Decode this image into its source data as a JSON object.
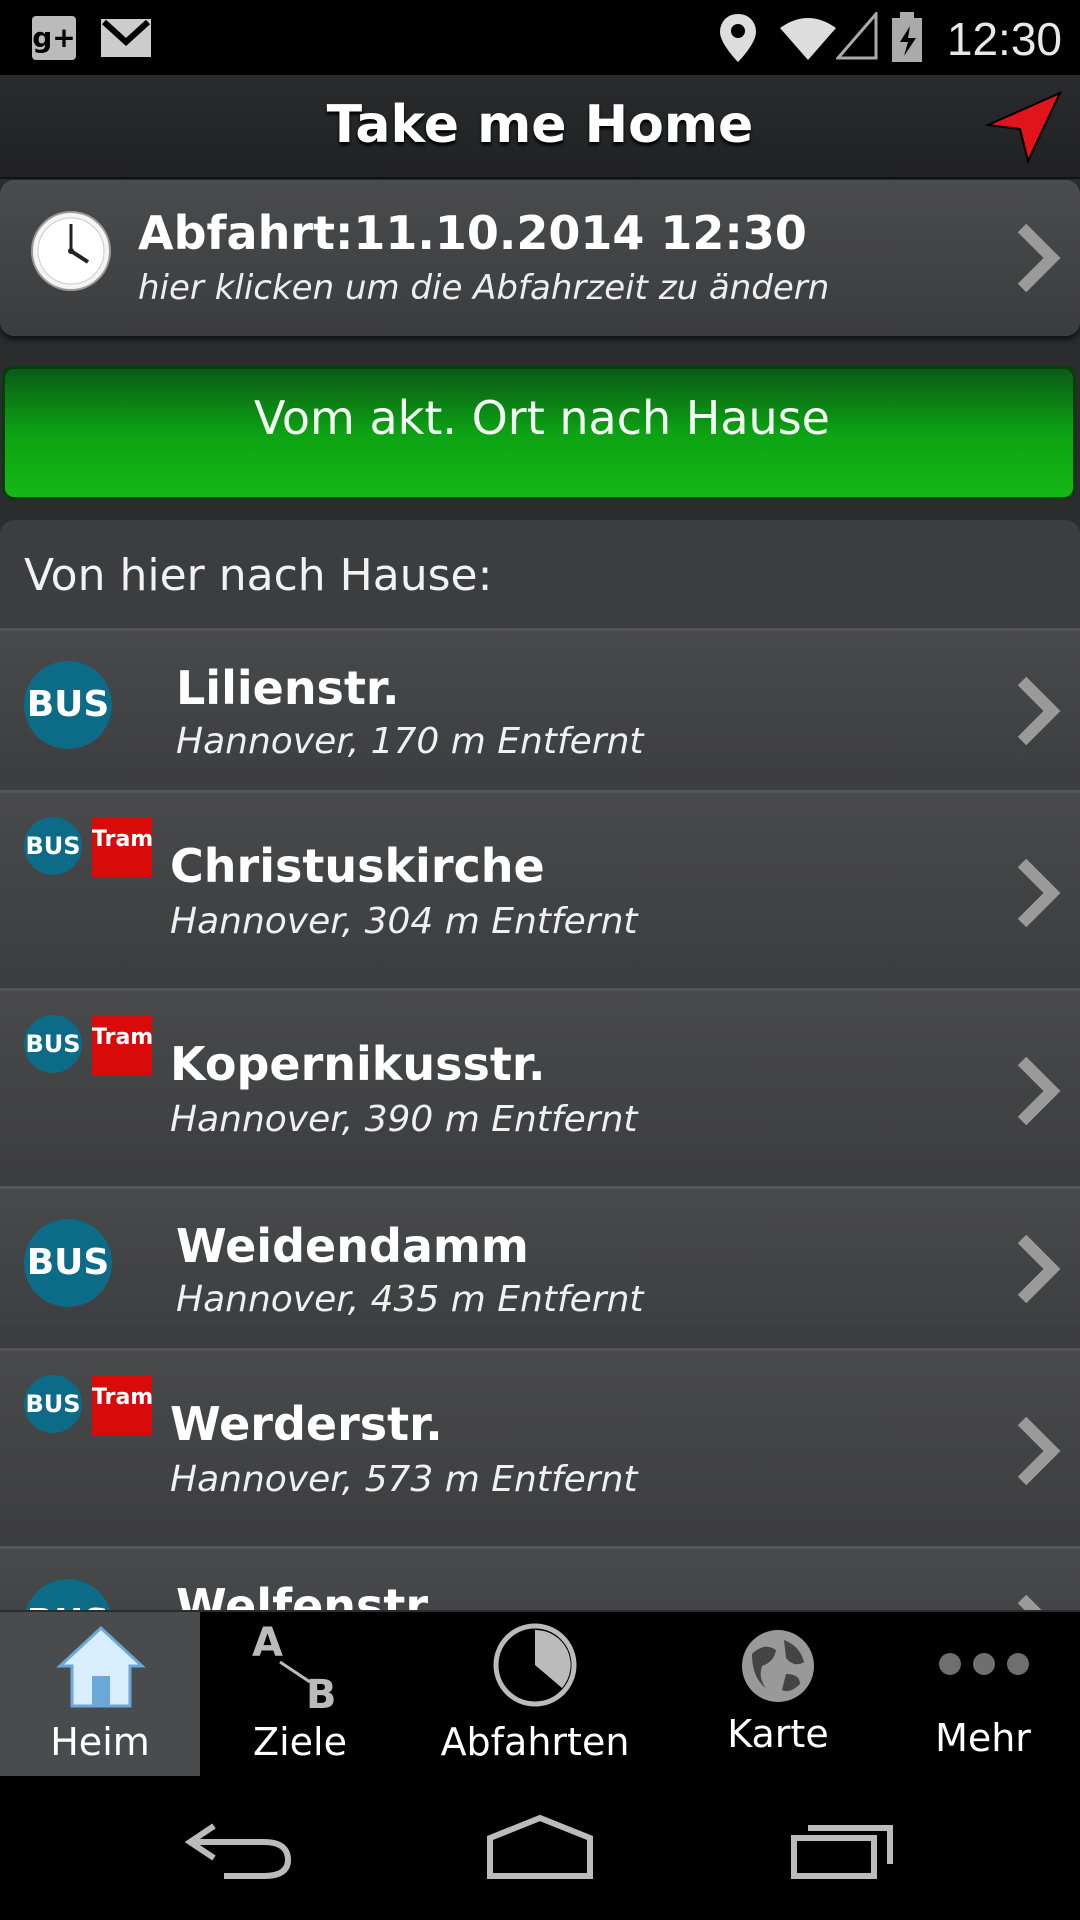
{
  "status_bar": {
    "time": "12:30"
  },
  "action_bar": {
    "title": "Take me Home"
  },
  "departure": {
    "heading": "Abfahrt:11.10.2014 12:30",
    "hint": "hier klicken um die Abfahrzeit zu ändern"
  },
  "home_button": {
    "label": "Vom akt. Ort nach Hause"
  },
  "list": {
    "header": "Von hier nach Hause:",
    "items": [
      {
        "name": "Lilienstr.",
        "detail": "Hannover, 170 m Entfernt",
        "modes": [
          "BUS"
        ]
      },
      {
        "name": "Christuskirche",
        "detail": "Hannover, 304 m Entfernt",
        "modes": [
          "BUS",
          "Tram"
        ]
      },
      {
        "name": "Kopernikusstr.",
        "detail": "Hannover, 390 m Entfernt",
        "modes": [
          "BUS",
          "Tram"
        ]
      },
      {
        "name": "Weidendamm",
        "detail": "Hannover, 435 m Entfernt",
        "modes": [
          "BUS"
        ]
      },
      {
        "name": "Werderstr.",
        "detail": "Hannover, 573 m Entfernt",
        "modes": [
          "BUS",
          "Tram"
        ]
      },
      {
        "name": "Welfenstr.",
        "detail": "",
        "modes": [
          "BUS"
        ]
      }
    ]
  },
  "bottom_nav": {
    "tabs": [
      {
        "label": "Heim",
        "icon": "home-icon",
        "active": true
      },
      {
        "label": "Ziele",
        "icon": "a-to-b-icon",
        "active": false
      },
      {
        "label": "Abfahrten",
        "icon": "pie-clock-icon",
        "active": false
      },
      {
        "label": "Karte",
        "icon": "globe-icon",
        "active": false
      },
      {
        "label": "Mehr",
        "icon": "more-dots-icon",
        "active": false
      }
    ]
  },
  "colors": {
    "accent_green": "#0da214",
    "bus_blue": "#0c6b87",
    "tram_red": "#d90a0a",
    "nav_arrow_red": "#e0141a"
  }
}
